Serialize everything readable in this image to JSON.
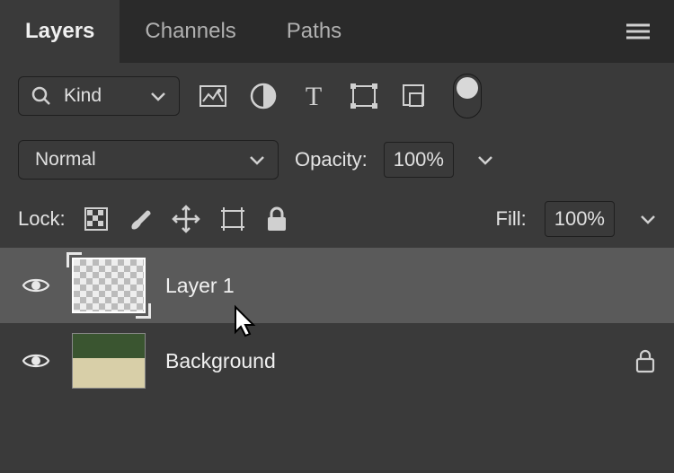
{
  "tabs": {
    "layers": "Layers",
    "channels": "Channels",
    "paths": "Paths"
  },
  "filter": {
    "kind": "Kind"
  },
  "blend": {
    "mode": "Normal",
    "opacity_label": "Opacity:",
    "opacity_value": "100%"
  },
  "lock": {
    "label": "Lock:",
    "fill_label": "Fill:",
    "fill_value": "100%"
  },
  "layers": [
    {
      "name": "Layer 1",
      "locked": false
    },
    {
      "name": "Background",
      "locked": true
    }
  ]
}
